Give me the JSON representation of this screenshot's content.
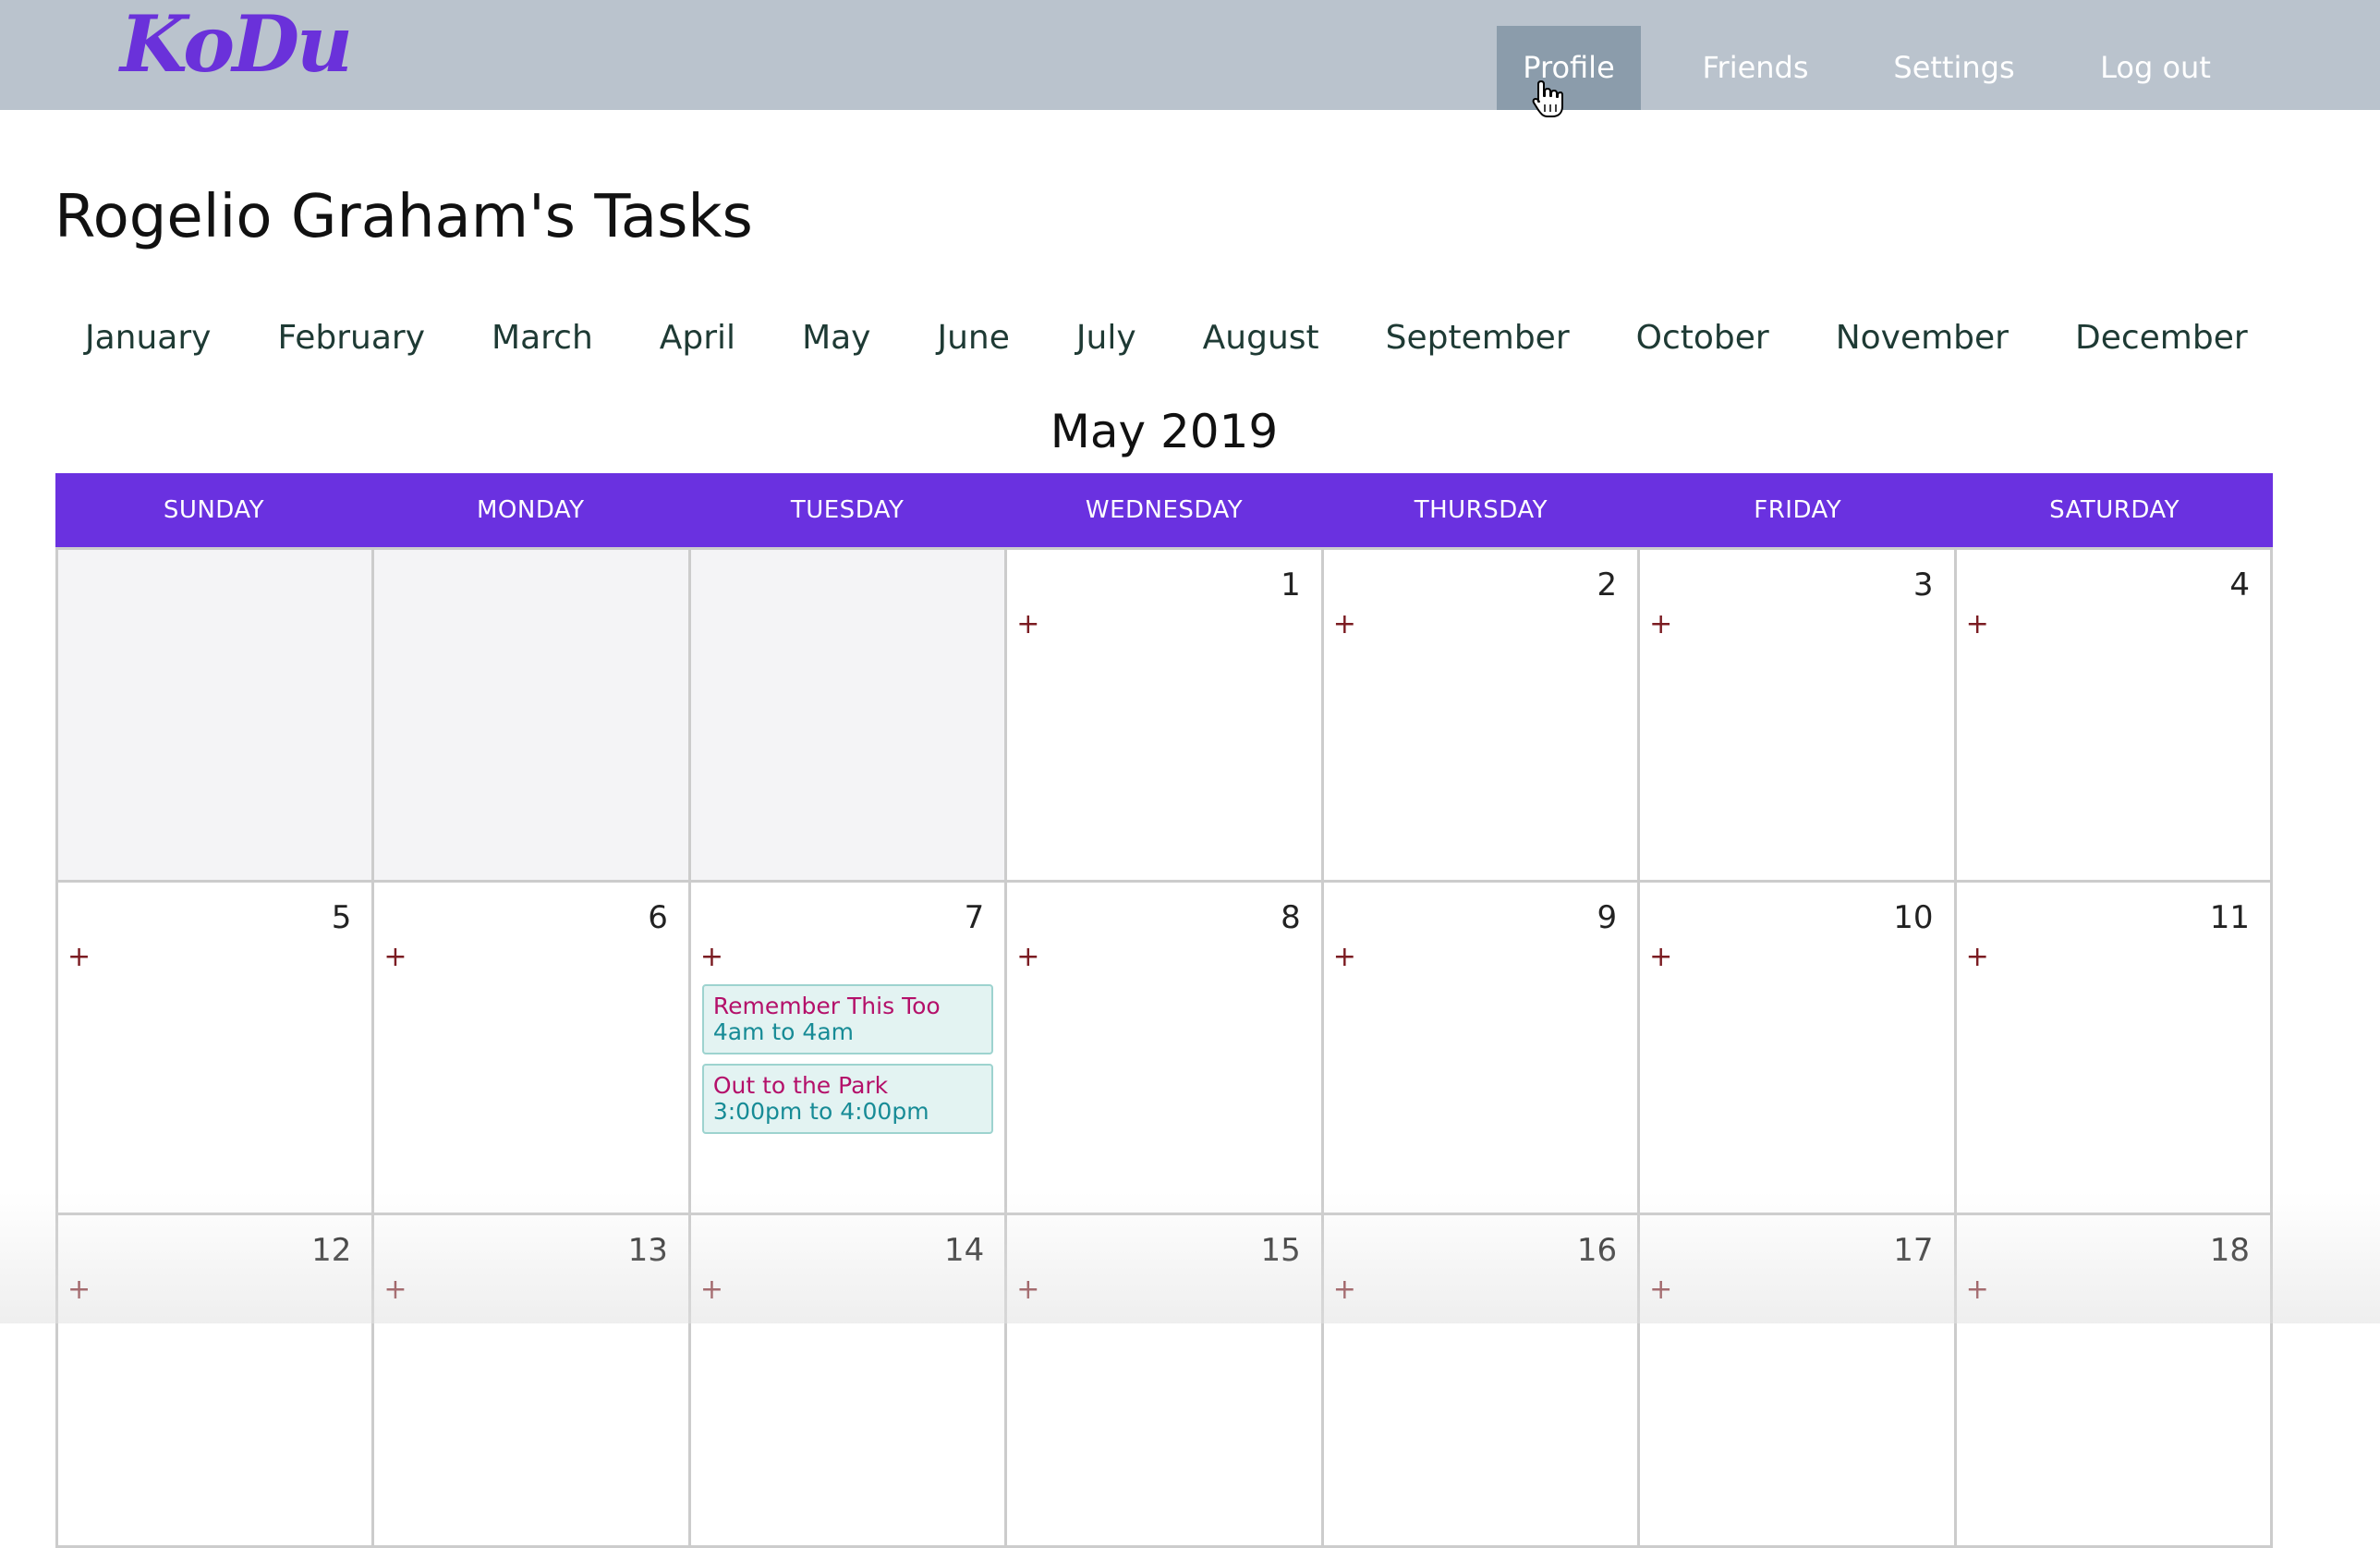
{
  "app": {
    "logo": "KoDu"
  },
  "nav": {
    "items": [
      {
        "label": "Profile",
        "active": true
      },
      {
        "label": "Friends",
        "active": false
      },
      {
        "label": "Settings",
        "active": false
      },
      {
        "label": "Log out",
        "active": false
      }
    ]
  },
  "page": {
    "title": "Rogelio Graham's Tasks"
  },
  "months": [
    "January",
    "February",
    "March",
    "April",
    "May",
    "June",
    "July",
    "August",
    "September",
    "October",
    "November",
    "December"
  ],
  "calendar": {
    "heading": "May 2019",
    "add_symbol": "+",
    "weekdays": [
      "SUNDAY",
      "MONDAY",
      "TUESDAY",
      "WEDNESDAY",
      "THURSDAY",
      "FRIDAY",
      "SATURDAY"
    ],
    "first_weekday_index": 3,
    "visible_days": 18,
    "tasks": {
      "7": [
        {
          "title": "Remember This Too",
          "time": "4am to 4am"
        },
        {
          "title": "Out to the Park",
          "time": "3:00pm to 4:00pm"
        }
      ]
    }
  },
  "colors": {
    "accent": "#6a31e0",
    "navbar": "#bac3cd",
    "nav_active": "#8b9cab",
    "task_title": "#b4106a",
    "task_time": "#178b96",
    "add_symbol": "#7b1c22"
  }
}
